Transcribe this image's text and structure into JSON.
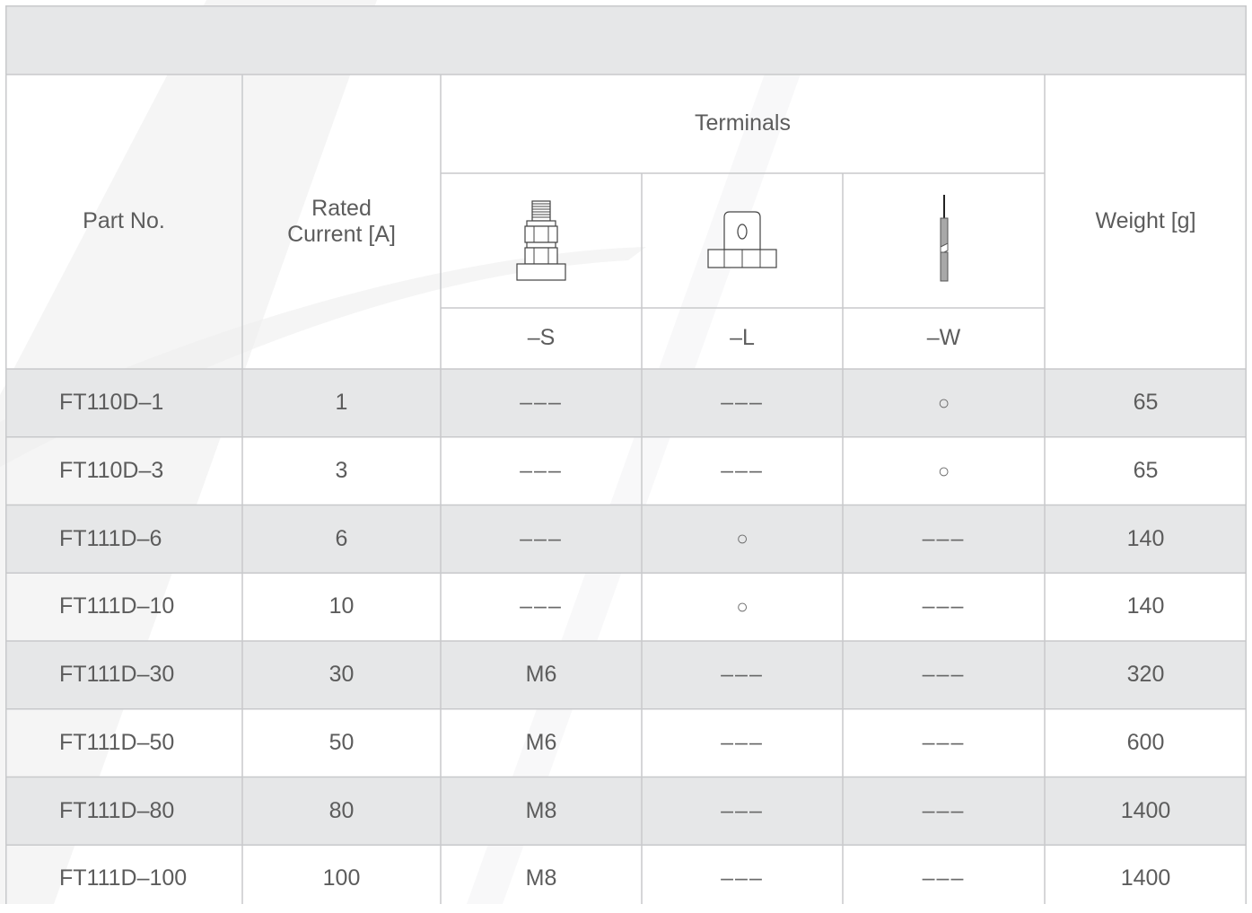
{
  "colors": {
    "header_band": "#e6e7e8",
    "row_shade": "#e6e7e8",
    "border": "#c8c9cb",
    "text": "#5c5c5c"
  },
  "headers": {
    "part_no": "Part No.",
    "rated_current": "Rated\nCurrent [A]",
    "terminals": "Terminals",
    "weight": "Weight [g]",
    "terminal_types": [
      {
        "suffix": "–S",
        "icon": "stud-terminal-icon"
      },
      {
        "suffix": "–L",
        "icon": "lug-terminal-icon"
      },
      {
        "suffix": "–W",
        "icon": "wire-terminal-icon"
      }
    ]
  },
  "rows": [
    {
      "part": "FT110D–1",
      "current": "1",
      "s": "–––",
      "l": "–––",
      "w": "○",
      "weight": "65"
    },
    {
      "part": "FT110D–3",
      "current": "3",
      "s": "–––",
      "l": "–––",
      "w": "○",
      "weight": "65"
    },
    {
      "part": "FT111D–6",
      "current": "6",
      "s": "–––",
      "l": "○",
      "w": "–––",
      "weight": "140"
    },
    {
      "part": "FT111D–10",
      "current": "10",
      "s": "–––",
      "l": "○",
      "w": "–––",
      "weight": "140"
    },
    {
      "part": "FT111D–30",
      "current": "30",
      "s": "M6",
      "l": "–––",
      "w": "–––",
      "weight": "320"
    },
    {
      "part": "FT111D–50",
      "current": "50",
      "s": "M6",
      "l": "–––",
      "w": "–––",
      "weight": "600"
    },
    {
      "part": "FT111D–80",
      "current": "80",
      "s": "M8",
      "l": "–––",
      "w": "–––",
      "weight": "1400"
    },
    {
      "part": "FT111D–100",
      "current": "100",
      "s": "M8",
      "l": "–––",
      "w": "–––",
      "weight": "1400"
    }
  ]
}
